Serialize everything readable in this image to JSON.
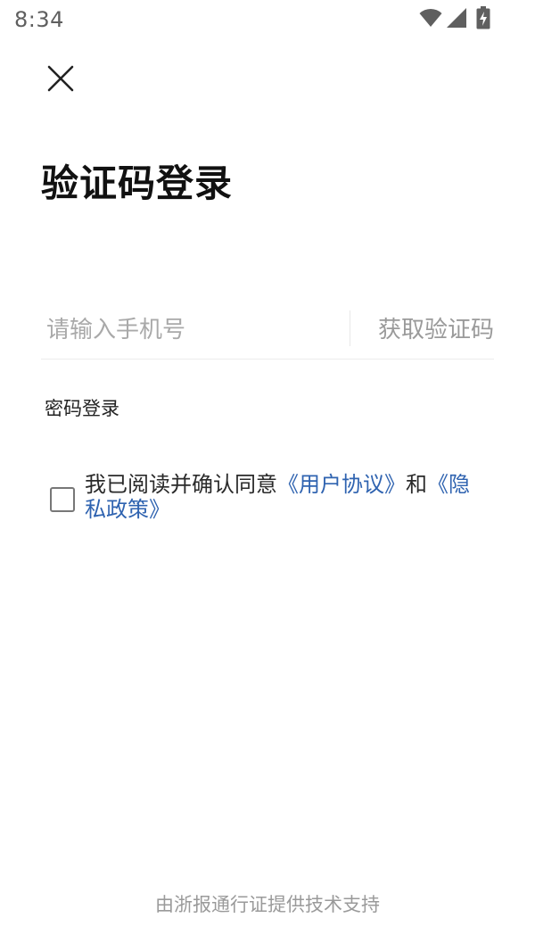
{
  "status_bar": {
    "time": "8:34",
    "icons": [
      "wifi-icon",
      "signal-icon",
      "battery-charging-icon"
    ]
  },
  "header": {
    "close_icon": "close-icon"
  },
  "title": "验证码登录",
  "phone_input": {
    "placeholder": "请输入手机号",
    "value": ""
  },
  "get_code_label": "获取验证码",
  "password_login_label": "密码登录",
  "agreement": {
    "checked": false,
    "prefix": "我已阅读并确认同意",
    "user_agreement": "《用户协议》",
    "conjunction": "和",
    "privacy_policy": "《隐私政策》"
  },
  "footer": "由浙报通行证提供技术支持",
  "colors": {
    "link": "#2f63b0",
    "placeholder": "#a9a9a9",
    "title": "#111111"
  }
}
